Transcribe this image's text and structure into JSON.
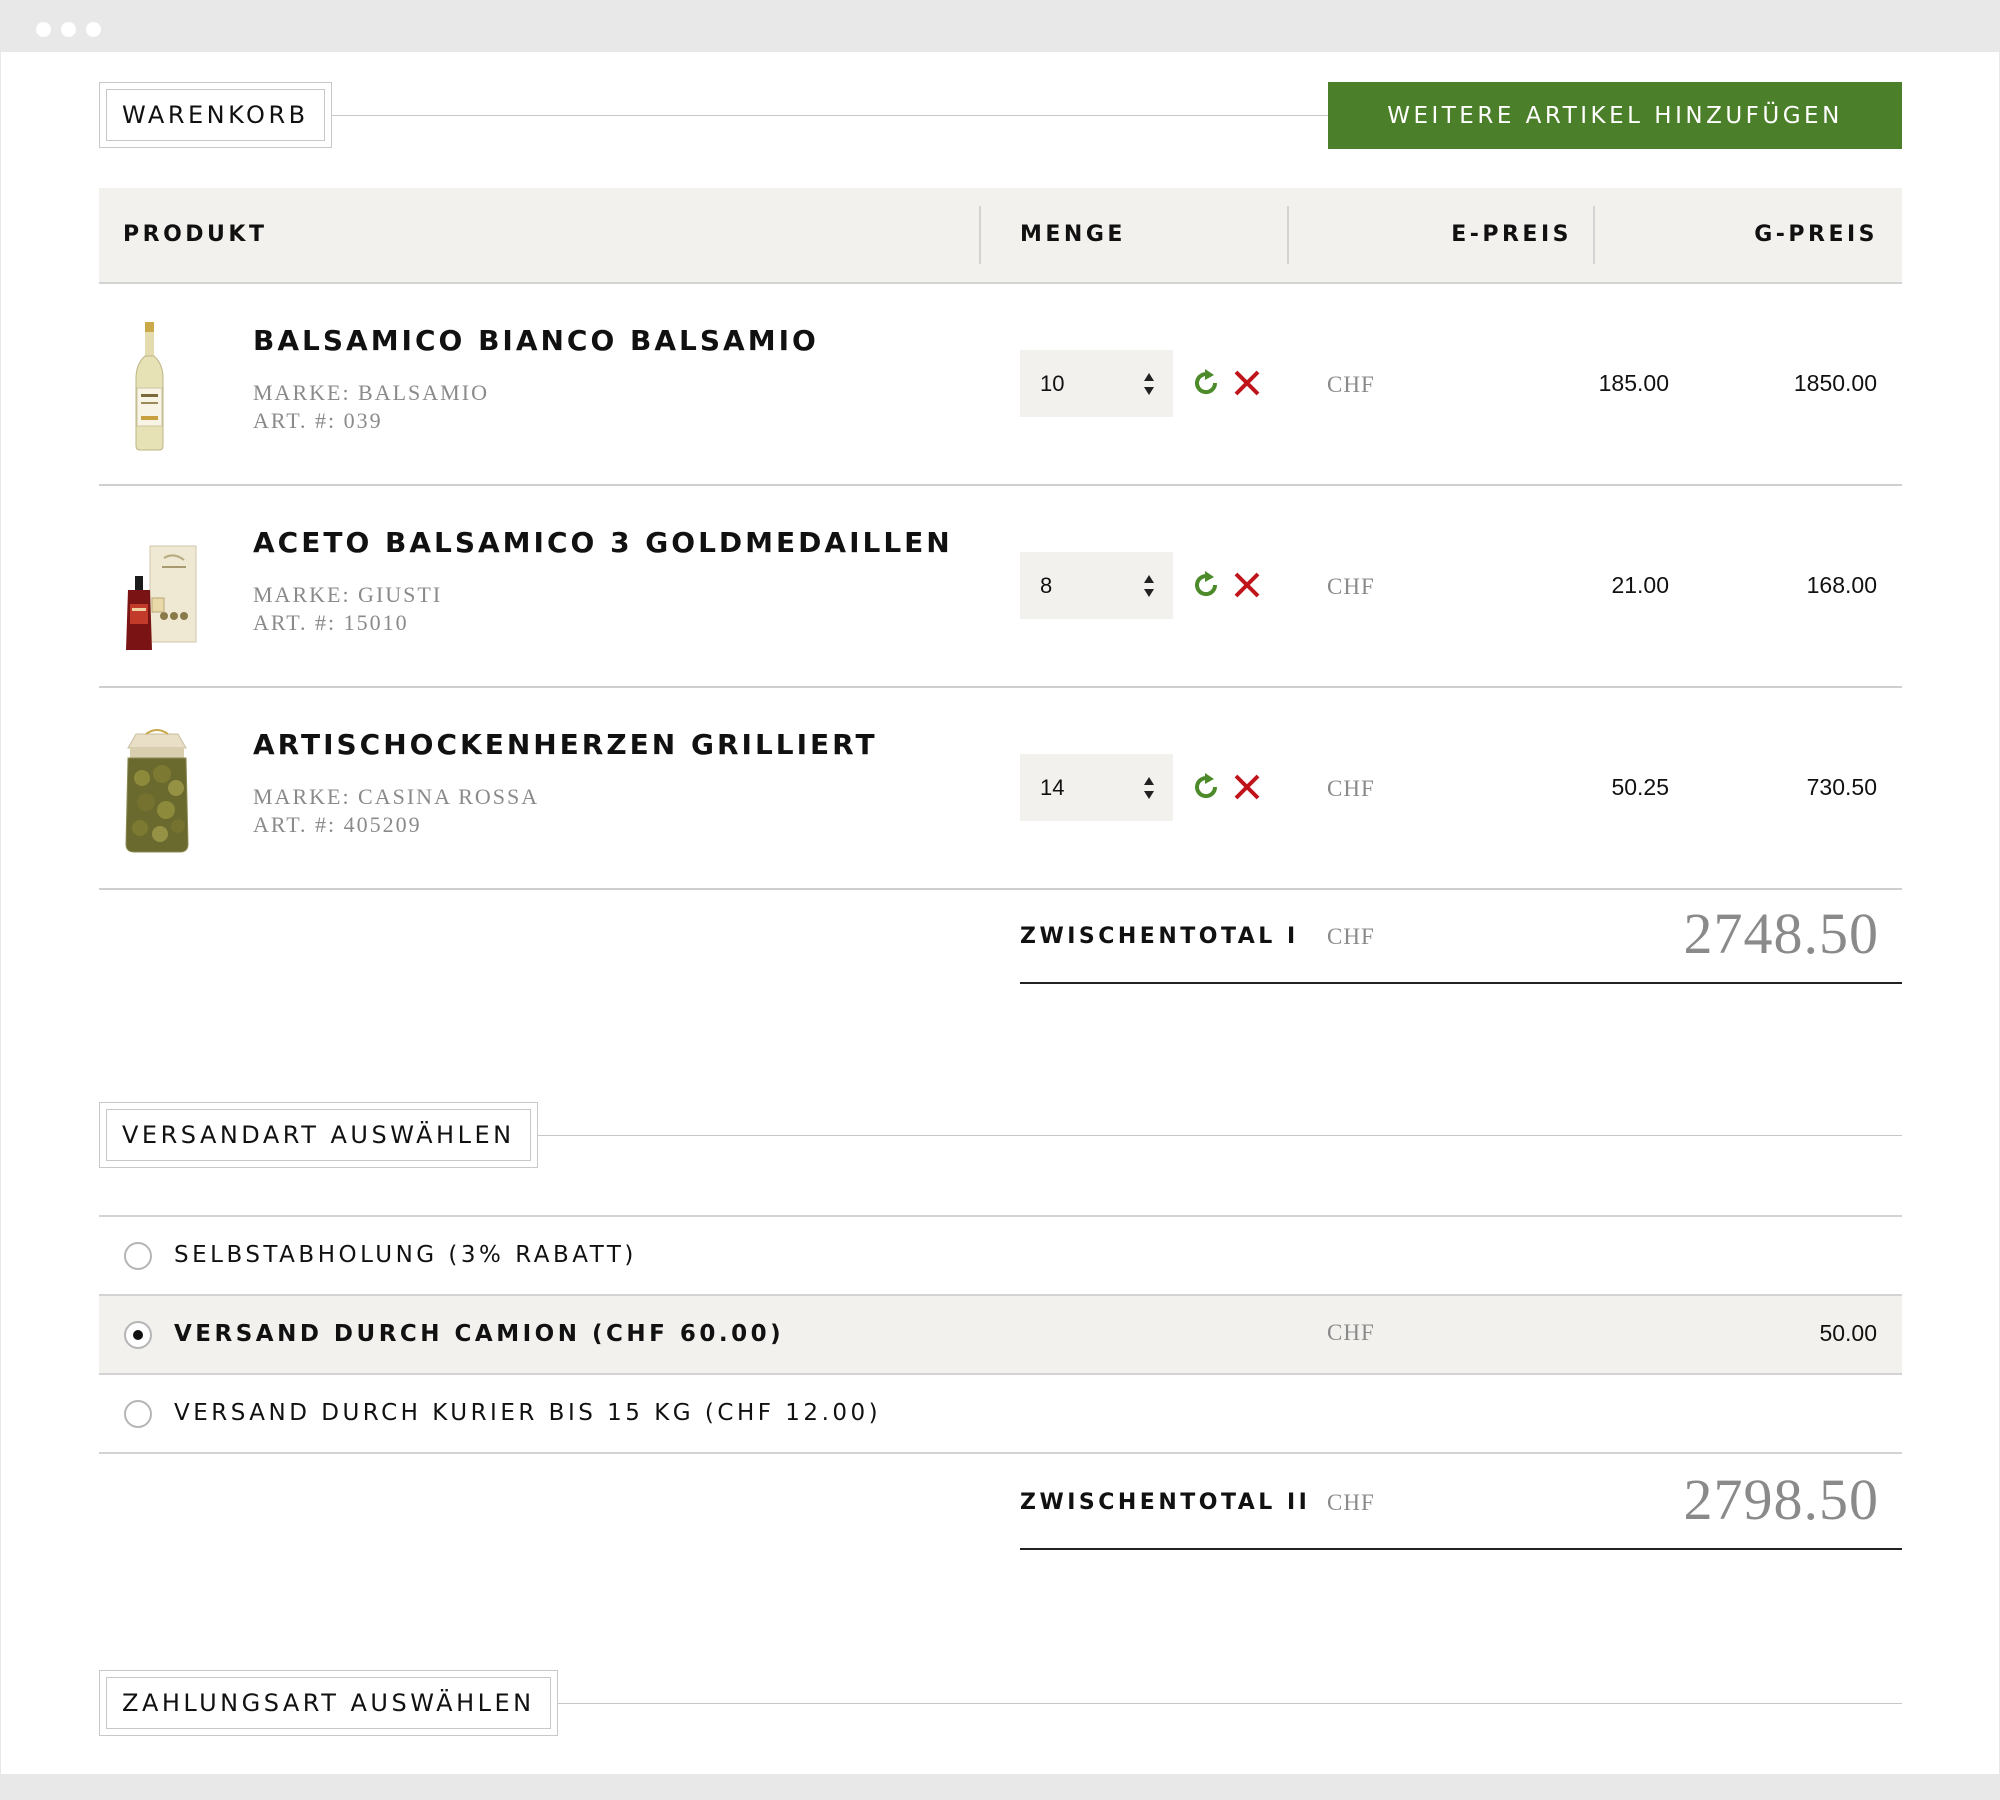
{
  "cart": {
    "title": "WARENKORB",
    "add_button": "WEITERE ARTIKEL HINZUFÜGEN",
    "columns": {
      "product": "PRODUKT",
      "quantity": "MENGE",
      "unit_price": "E-PREIS",
      "total_price": "G-PREIS"
    },
    "items": [
      {
        "name": "BALSAMICO BIANCO BALSAMIO",
        "brand": "MARKE: BALSAMIO",
        "article": "ART. #: 039",
        "quantity": "10",
        "currency": "CHF",
        "unit_price": "185.00",
        "total_price": "1850.00",
        "image": "white-wine-bottle"
      },
      {
        "name": "ACETO BALSAMICO 3 GOLDMEDAILLEN",
        "brand": "MARKE: GIUSTI",
        "article": "ART. #: 15010",
        "quantity": "8",
        "currency": "CHF",
        "unit_price": "21.00",
        "total_price": "168.00",
        "image": "balsamic-gift-box"
      },
      {
        "name": "ARTISCHOCKENHERZEN GRILLIERT",
        "brand": "MARKE: CASINA ROSSA",
        "article": "ART. #: 405209",
        "quantity": "14",
        "currency": "CHF",
        "unit_price": "50.25",
        "total_price": "730.50",
        "image": "artichoke-jar"
      }
    ],
    "subtotal": {
      "label": "ZWISCHENTOTAL I",
      "currency": "CHF",
      "value": "2748.50"
    }
  },
  "shipping": {
    "title": "VERSANDART AUSWÄHLEN",
    "options": [
      {
        "label": "SELBSTABHOLUNG (3% RABATT)",
        "selected": false
      },
      {
        "label": "VERSAND DURCH CAMION (CHF 60.00)",
        "selected": true,
        "currency": "CHF",
        "price": "50.00"
      },
      {
        "label": "VERSAND DURCH KURIER BIS 15 KG (CHF 12.00)",
        "selected": false
      }
    ],
    "subtotal": {
      "label": "ZWISCHENTOTAL II",
      "currency": "CHF",
      "value": "2798.50"
    }
  },
  "payment": {
    "title": "ZAHLUNGSART AUSWÄHLEN"
  },
  "colors": {
    "accent_green": "#4c7f2a",
    "remove_red": "#c0141b",
    "refresh_green": "#4c8a2a",
    "muted_gray": "#8a8a8a",
    "header_bg": "#f2f1ee"
  }
}
